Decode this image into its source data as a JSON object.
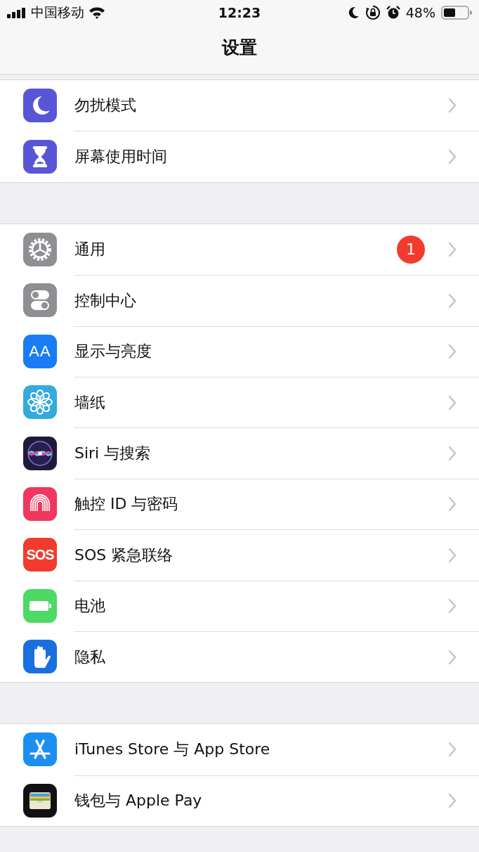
{
  "status_bar": {
    "carrier": "中国移动",
    "time": "12:23",
    "battery": "48%"
  },
  "nav": {
    "title": "设置"
  },
  "groups": [
    {
      "rows": [
        {
          "kind": "moon",
          "label": "勿扰模式"
        },
        {
          "kind": "hourglass",
          "label": "屏幕使用时间"
        }
      ]
    },
    {
      "rows": [
        {
          "kind": "gear",
          "label": "通用",
          "badge": "1"
        },
        {
          "kind": "switches",
          "label": "控制中心"
        },
        {
          "kind": "text",
          "icon_text": "AA",
          "label": "显示与亮度"
        },
        {
          "kind": "flower",
          "label": "墙纸"
        },
        {
          "kind": "siri",
          "label": "Siri 与搜索"
        },
        {
          "kind": "fingerprint",
          "label": "触控 ID 与密码"
        },
        {
          "kind": "sos",
          "icon_text": "SOS",
          "label": "SOS 紧急联络"
        },
        {
          "kind": "battery",
          "label": "电池"
        },
        {
          "kind": "hand",
          "label": "隐私"
        }
      ]
    },
    {
      "rows": [
        {
          "kind": "appstore",
          "label": "iTunes Store 与 App Store"
        },
        {
          "kind": "wallet",
          "label": "钱包与 Apple Pay"
        }
      ]
    }
  ]
}
